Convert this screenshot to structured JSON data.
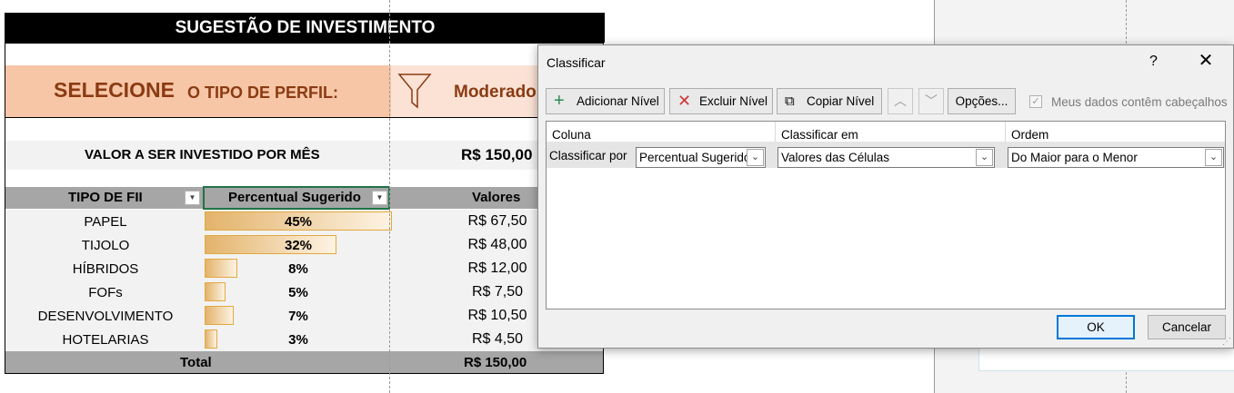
{
  "sheet": {
    "title": "SUGESTÃO DE INVESTIMENTO",
    "select_big": "SELECIONE",
    "select_small": "O TIPO DE PERFIL:",
    "profile_value": "Moderado",
    "invest_label": "VALOR A SER INVESTIDO POR MÊS",
    "invest_value": "R$ 150,00",
    "headers": {
      "tipo": "TIPO DE FII",
      "percentual": "Percentual Sugerido",
      "valores": "Valores"
    },
    "rows": [
      {
        "tipo": "PAPEL",
        "pct": "45%",
        "fill": 0.45,
        "valor": "R$ 67,50"
      },
      {
        "tipo": "TIJOLO",
        "pct": "32%",
        "fill": 0.32,
        "valor": "R$ 48,00"
      },
      {
        "tipo": "HÍBRIDOS",
        "pct": "8%",
        "fill": 0.08,
        "valor": "R$ 12,00"
      },
      {
        "tipo": "FOFs",
        "pct": "5%",
        "fill": 0.05,
        "valor": "R$ 7,50"
      },
      {
        "tipo": "DESENVOLVIMENTO",
        "pct": "7%",
        "fill": 0.07,
        "valor": "R$ 10,50"
      },
      {
        "tipo": "HOTELARIAS",
        "pct": "3%",
        "fill": 0.03,
        "valor": "R$ 4,50"
      }
    ],
    "total_label": "Total",
    "total_value": "R$ 150,00"
  },
  "dialog": {
    "title": "Classificar",
    "help": "?",
    "close": "✕",
    "toolbar": {
      "add_level": "Adicionar Nível",
      "delete_level": "Excluir Nível",
      "copy_level": "Copiar Nível",
      "options": "Opções...",
      "has_headers": "Meus dados contêm cabeçalhos"
    },
    "columns": {
      "coluna": "Coluna",
      "classificar_em": "Classificar em",
      "ordem": "Ordem"
    },
    "sort_row": {
      "label": "Classificar por",
      "column": "Percentual Sugerido",
      "sort_on": "Valores das Células",
      "order": "Do Maior para o Menor"
    },
    "ok": "OK",
    "cancel": "Cancelar"
  },
  "colors": {
    "accent": "#217346",
    "profile_text": "#8a3b12",
    "dialog_focus": "#0078d7"
  }
}
